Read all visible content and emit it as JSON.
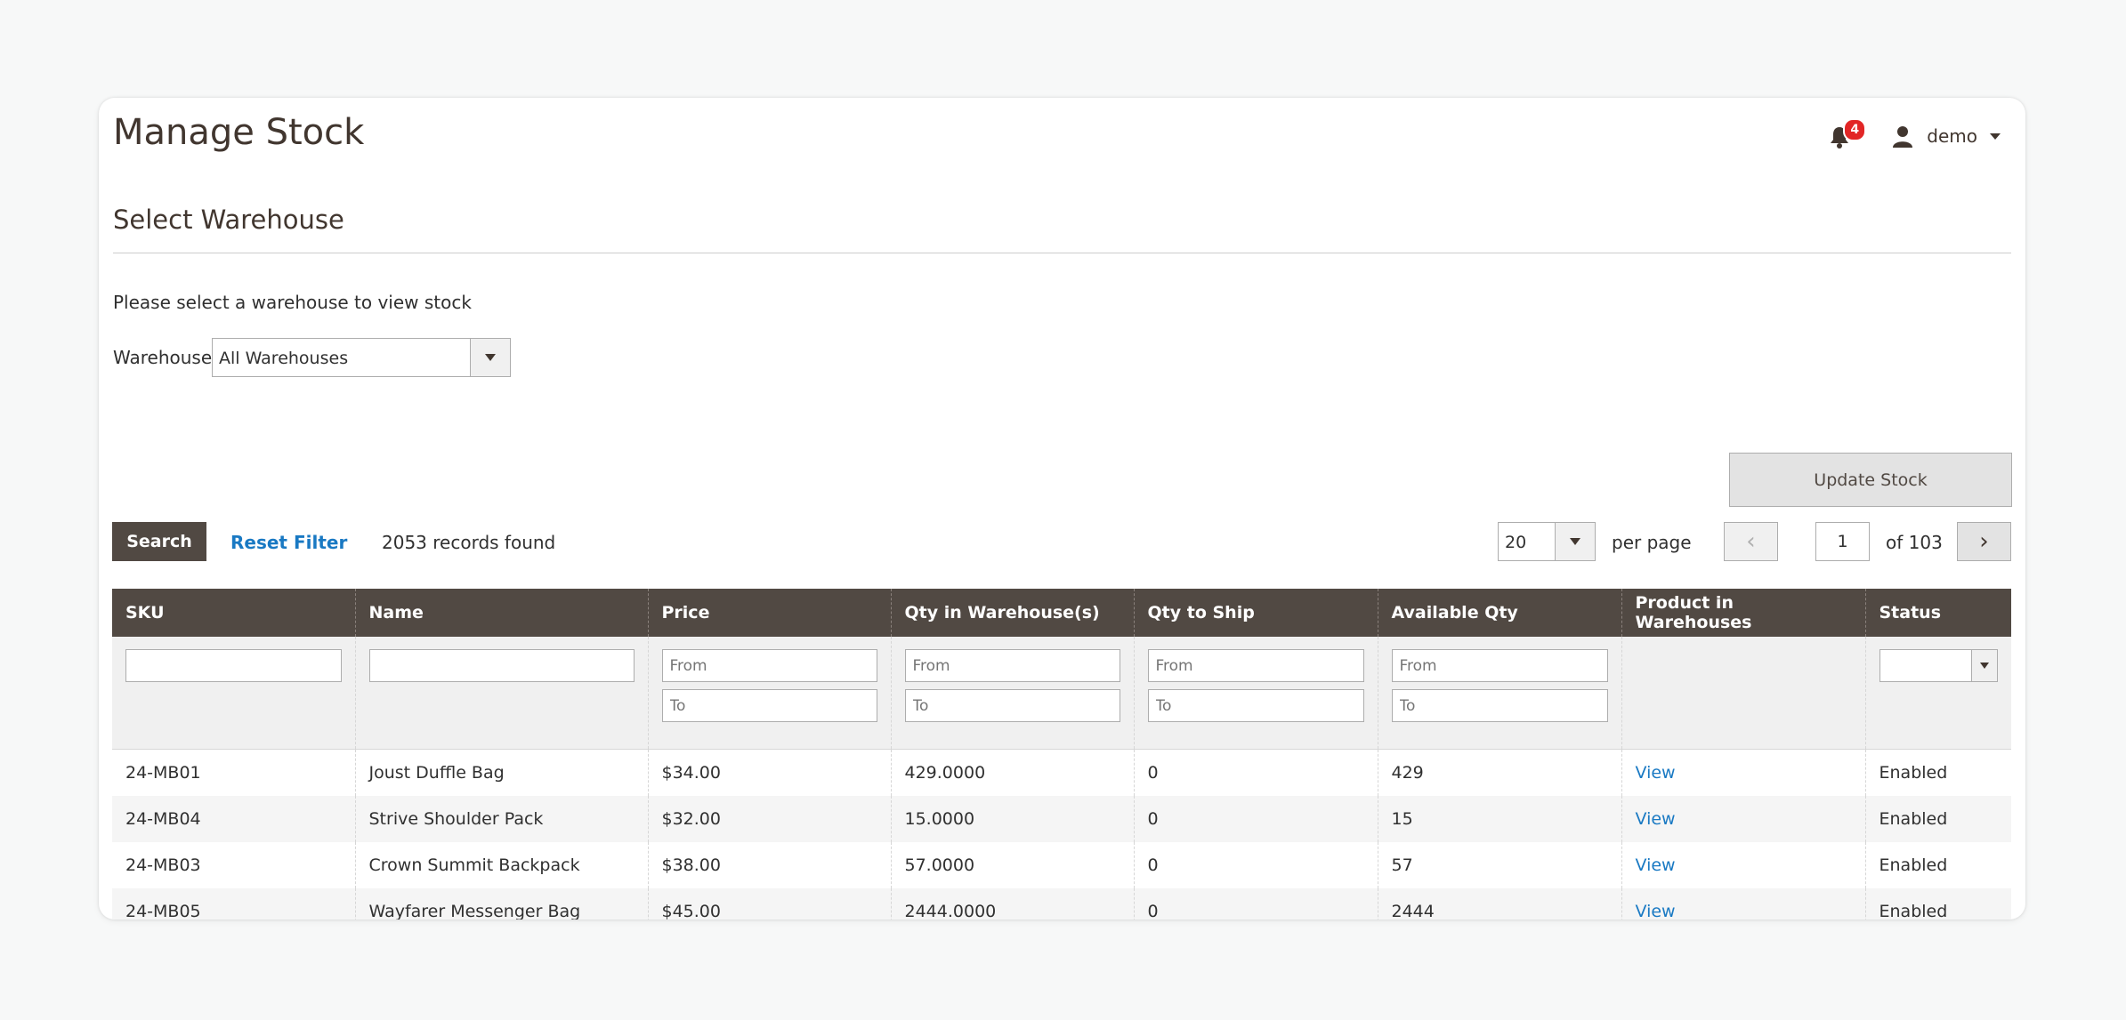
{
  "header": {
    "title": "Manage Stock",
    "notification_count": "4",
    "user_name": "demo"
  },
  "warehouse": {
    "section_title": "Select Warehouse",
    "hint": "Please select a warehouse to view stock",
    "label": "Warehouse",
    "selected": "All Warehouses"
  },
  "actions": {
    "update_stock": "Update Stock",
    "search": "Search",
    "reset_filter": "Reset Filter",
    "records_found": "2053 records found"
  },
  "pagination": {
    "per_page_value": "20",
    "per_page_label": "per page",
    "current_page": "1",
    "of_pages": "of 103"
  },
  "table": {
    "columns": [
      "SKU",
      "Name",
      "Price",
      "Qty in Warehouse(s)",
      "Qty to Ship",
      "Available Qty",
      "Product in Warehouses",
      "Status"
    ],
    "filter_from": "From",
    "filter_to": "To",
    "rows": [
      {
        "sku": "24-MB01",
        "name": "Joust Duffle Bag",
        "price": "$34.00",
        "qty_wh": "429.0000",
        "qty_ship": "0",
        "avail": "429",
        "link": "View",
        "status": "Enabled"
      },
      {
        "sku": "24-MB04",
        "name": "Strive Shoulder Pack",
        "price": "$32.00",
        "qty_wh": "15.0000",
        "qty_ship": "0",
        "avail": "15",
        "link": "View",
        "status": "Enabled"
      },
      {
        "sku": "24-MB03",
        "name": "Crown Summit Backpack",
        "price": "$38.00",
        "qty_wh": "57.0000",
        "qty_ship": "0",
        "avail": "57",
        "link": "View",
        "status": "Enabled"
      },
      {
        "sku": "24-MB05",
        "name": "Wayfarer Messenger Bag",
        "price": "$45.00",
        "qty_wh": "2444.0000",
        "qty_ship": "0",
        "avail": "2444",
        "link": "View",
        "status": "Enabled"
      }
    ]
  },
  "colors": {
    "header_bg": "#514943",
    "link": "#1979c3",
    "badge": "#e22626"
  }
}
